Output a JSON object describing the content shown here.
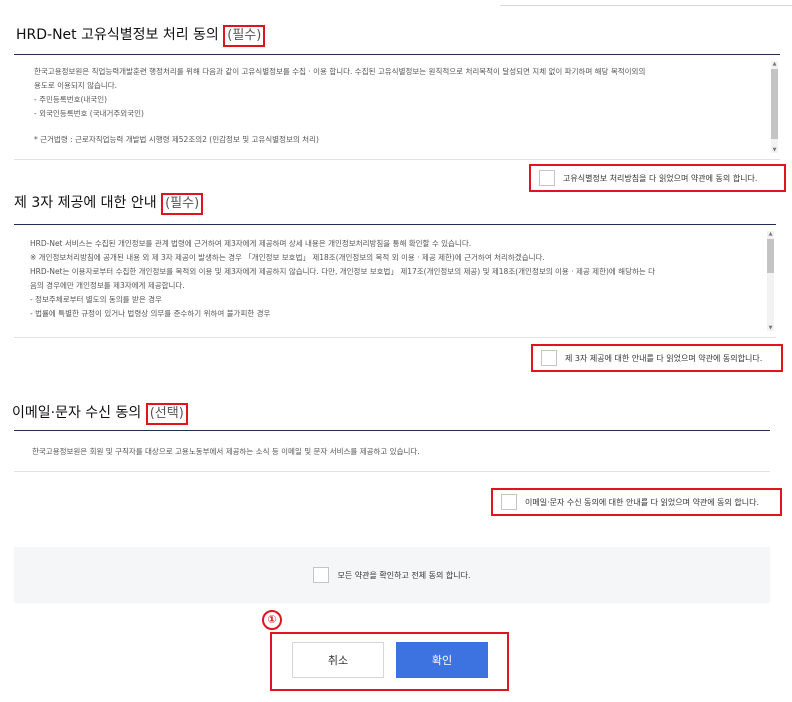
{
  "sections": [
    {
      "title": "HRD-Net 고유식별정보 처리 동의",
      "tag": "(필수)",
      "lines": [
        "한국고용정보원은 직업능력개발훈련 행정처리를 위해 다음과 같이 고유식별정보를 수집 · 이용 합니다. 수집된 고유식별정보는 원칙적으로 처리목적이 달성되면 지체 없이 파기하며 해당 목적이외의",
        "용도로 이용되지 않습니다.",
        "- 주민등록번호(내국인)",
        "- 외국인등록번호 (국내거주외국인)",
        "",
        "* 근거법령 : 근로자직업능력 개발법 시행령 제52조의2 (민감정보 및 고유식별정보의 처리)"
      ],
      "agree_label": "고유식별정보 처리방침을 다 읽었으며 약관에 동의 합니다."
    },
    {
      "title": "제 3자 제공에 대한 안내",
      "tag": "(필수)",
      "lines": [
        "HRD-Net 서비스는 수집된 개인정보를 관계 법령에 근거하여 제3자에게 제공하며 상세 내용은 개인정보처리방침을 통해 확인할 수 있습니다.",
        "※ 개인정보처리방침에 공개된 내용 외 제 3자 제공이 발생하는 경우 「개인정보 보호법」 제18조(개인정보의 목적 외 이용 · 제공 제한)에 근거하여 처리하겠습니다.",
        "HRD-Net는 이용자로부터 수집한 개인정보를 목적외 이용 및 제3자에게 제공하지 않습니다. 다만, 개인정보 보호법」 제17조(개인정보의 제공) 및 제18조(개인정보의 이용 · 제공 제한)에 해당하는 다",
        "음의 경우에만 개인정보를 제3자에게 제공합니다.",
        "- 정보주체로부터 별도의 동의를 받은 경우",
        "- 법률에 특별한 규정이 있거나 법령상 의무를 준수하기 위하여 불가피한 경우"
      ],
      "agree_label": "제 3자 제공에 대한 안내를 다 읽었으며 약관에 동의합니다."
    },
    {
      "title": "이메일·문자 수신 동의",
      "tag": "(선택)",
      "lines": [
        "한국고용정보원은 회원 및 구직자를 대상으로 고용노동부에서 제공하는 소식 등 이메일 및 문자 서비스를 제공하고 있습니다."
      ],
      "agree_label": "이메일·문자 수신 동의에 대한 안내를 다 읽었으며 약관에 동의 합니다."
    }
  ],
  "agree_all_label": "모든 약관을 확인하고 전체 동의 합니다.",
  "marker": "①",
  "buttons": {
    "cancel": "취소",
    "confirm": "확인"
  },
  "colors": {
    "highlight": "#e0141e",
    "primary": "#3d73e0",
    "border_dark": "#1f2d55"
  },
  "icons": {
    "scroll_up": "▲",
    "scroll_down": "▼"
  }
}
